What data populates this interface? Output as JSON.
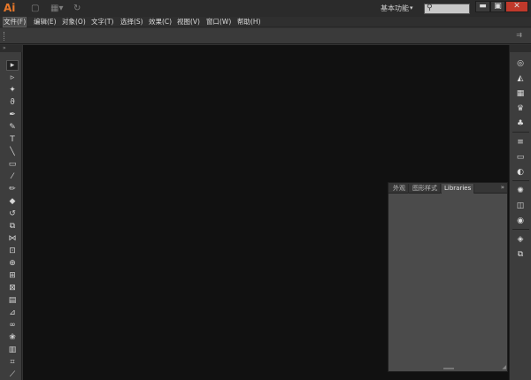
{
  "app": {
    "logo": "Ai"
  },
  "titlebar": {
    "doc_icon": "▢",
    "arrange_icon": "▦▾",
    "sync_icon": "↻",
    "workspace_label": "基本功能",
    "workspace_caret": "▾",
    "search_glyph": "⚲",
    "minimize": "▬",
    "maximize": "▣",
    "close": "✕"
  },
  "menu": [
    {
      "label": "文件(F)"
    },
    {
      "label": "编辑(E)"
    },
    {
      "label": "对象(O)"
    },
    {
      "label": "文字(T)"
    },
    {
      "label": "选择(S)"
    },
    {
      "label": "效果(C)"
    },
    {
      "label": "视图(V)"
    },
    {
      "label": "窗口(W)"
    },
    {
      "label": "帮助(H)"
    }
  ],
  "controlbar": {
    "menu_glyph": "⇉"
  },
  "tools": {
    "header": "»",
    "items": [
      {
        "icon": "selection-icon",
        "glyph": "▸"
      },
      {
        "icon": "direct-selection-icon",
        "glyph": "▹"
      },
      {
        "icon": "magic-wand-icon",
        "glyph": "✦"
      },
      {
        "icon": "lasso-icon",
        "glyph": "ϑ"
      },
      {
        "icon": "pen-icon",
        "glyph": "✒"
      },
      {
        "icon": "curvature-icon",
        "glyph": "✎"
      },
      {
        "icon": "type-icon",
        "glyph": "T"
      },
      {
        "icon": "line-icon",
        "glyph": "╲"
      },
      {
        "icon": "rectangle-icon",
        "glyph": "▭"
      },
      {
        "icon": "paintbrush-icon",
        "glyph": "⁄"
      },
      {
        "icon": "pencil-icon",
        "glyph": "✏"
      },
      {
        "icon": "eraser-icon",
        "glyph": "◆"
      },
      {
        "icon": "rotate-icon",
        "glyph": "↺"
      },
      {
        "icon": "scale-icon",
        "glyph": "⧉"
      },
      {
        "icon": "width-icon",
        "glyph": "⋈"
      },
      {
        "icon": "free-transform-icon",
        "glyph": "⊡"
      },
      {
        "icon": "shape-builder-icon",
        "glyph": "⊕"
      },
      {
        "icon": "perspective-grid-icon",
        "glyph": "⊞"
      },
      {
        "icon": "mesh-icon",
        "glyph": "⊠"
      },
      {
        "icon": "gradient-icon",
        "glyph": "▤"
      },
      {
        "icon": "eyedropper-icon",
        "glyph": "⊿"
      },
      {
        "icon": "blend-icon",
        "glyph": "∞"
      },
      {
        "icon": "symbol-sprayer-icon",
        "glyph": "❀"
      },
      {
        "icon": "column-graph-icon",
        "glyph": "▥"
      },
      {
        "icon": "artboard-icon",
        "glyph": "⌗"
      },
      {
        "icon": "slice-icon",
        "glyph": "⟋"
      }
    ]
  },
  "dock": {
    "items": [
      {
        "icon": "color-icon",
        "glyph": "◎"
      },
      {
        "icon": "color-guide-icon",
        "glyph": "◭"
      },
      {
        "icon": "swatches-icon",
        "glyph": "▦"
      },
      {
        "icon": "brushes-icon",
        "glyph": "♛"
      },
      {
        "icon": "symbols-icon",
        "glyph": "♣"
      },
      {
        "icon": "stroke-icon",
        "glyph": "≡"
      },
      {
        "icon": "gradient-panel-icon",
        "glyph": "▭"
      },
      {
        "icon": "transparency-icon",
        "glyph": "◐"
      },
      {
        "icon": "appearance-icon",
        "glyph": "✺"
      },
      {
        "icon": "graphic-styles-icon",
        "glyph": "◫"
      },
      {
        "icon": "libraries-icon",
        "glyph": "◉"
      },
      {
        "icon": "layers-icon",
        "glyph": "◈"
      },
      {
        "icon": "artboards-icon",
        "glyph": "⧉"
      }
    ]
  },
  "panel": {
    "tabs": [
      {
        "label": "外观"
      },
      {
        "label": "图形样式"
      },
      {
        "label": "Libraries"
      }
    ],
    "collapse": "»",
    "resize": "◢"
  },
  "colors": {
    "accent": "#e8782a",
    "canvas": "#111111",
    "panel": "#4b4b4b",
    "chrome": "#3d3d3d"
  }
}
